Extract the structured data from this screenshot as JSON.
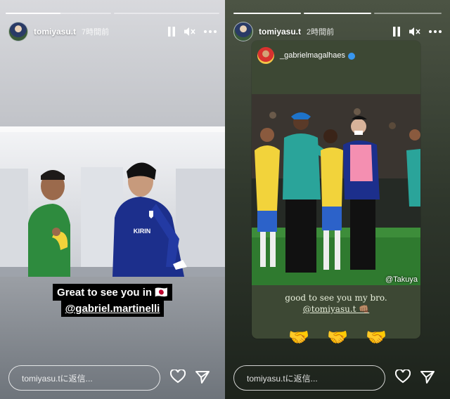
{
  "story1": {
    "username": "tomiyasu.t",
    "time_ago": "7時間前",
    "caption_line1": "Great to see you in 🇯🇵",
    "caption_line2": "@gabriel.martinelli",
    "reply_placeholder": "tomiyasu.tに返信...",
    "progress": [
      1,
      0
    ]
  },
  "story2": {
    "username": "tomiyasu.t",
    "time_ago": "2時間前",
    "shared_user": "_gabrielmagalhaes",
    "photo_credit": "@Takuya",
    "text_line1": "good to see you my bro.",
    "text_line2": "@tomiyasu.t 👊🏽",
    "emoji": [
      "🤝",
      "🤝",
      "🤝"
    ],
    "reply_placeholder": "tomiyasu.tに返信...",
    "progress": [
      1,
      1,
      0
    ]
  },
  "icons": {
    "pause": "pause-icon",
    "mute": "mute-icon",
    "more": "more-icon",
    "heart": "heart-icon",
    "send": "send-icon"
  },
  "colors": {
    "verified": "#3897f0",
    "japan_blue": "#1c2f8c",
    "brazil_yellow": "#f2d33b",
    "brazil_green": "#2e8b3e"
  }
}
